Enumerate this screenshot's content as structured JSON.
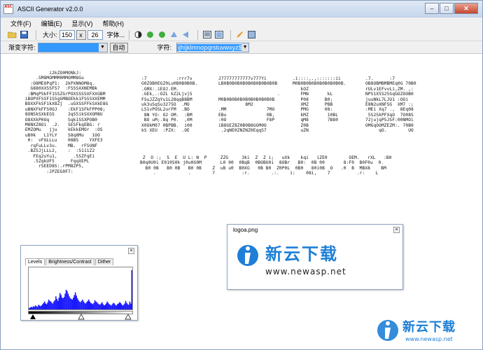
{
  "window": {
    "title": "ASCII Generator v2.0.0",
    "icon_text": "ASC\nBCD\nEFG"
  },
  "menu": [
    "文件(F)",
    "编辑(E)",
    "显示(V)",
    "帮助(H)"
  ],
  "toolbar": {
    "size_label": "大小:",
    "width": "150",
    "x_label": "x",
    "height": "26",
    "font_label": "字体..."
  },
  "toolbar2": {
    "ramp_label": "渐变字符:",
    "auto_label": "自动",
    "chars_label": "字符:",
    "chars_value": "ijhijklmnopqrstuvwxyz$"
  },
  "ascii_art": {
    "block_a": "          i2kZO0MONkJ:\n     .SM8MOMMM0MMOMM8Gu\n   :O8MEOPqP1:  2kPXNNOM8q.\n   G880XXSSFS7  :FSSSXXNEMBk\n  :BMqPSkFF1SSZGrPOXSSSSXFXXGBM\n iBOPXFSSF1S5gGMBOEkk1FSSSXXEMM\n BOXXFkSF1kX8Zj  .uGXSSFFkSXkE8G\n uBNXFkFFS0OJ    :EkF1SFkFPP08;\n 8ONSkSXkEGS     2qS5ikSXXGM8U\n O8XXkP0Oq       Sqk1SSXPOB0\n M8NXZ8Oi  .2.   SESFkqEBG: r\n EMZOMu   jju    kEkkEMOr  :OS\n uB0k   L1YLY    S8q8Mu   1OO\n  0:  vFULLLu    08BS    YXFE3\n   rqFuLLv3u.    MB.  rFSUNF\n  .BZSJjLLL2,    :  :S111Z2\n    FEq2uYu1,      .5SZFqEi\n    .5ZqkUF5      FqqXEPL\n      rSEED8S:.rPM8ZP5,\n         :JPZEG0F7:",
    "block_b": ":7           :rrr7v\nG0ZOB0EGZ0Lu0B0B0B0B.\n.GMX:.iEOJ.EM.\n.GEk,.:OZL kZ2LjvjS\nFSuJZZqYu1L28qqB8BM\nuk3uSqSu3275O  .MO\nLS1vPOSL2urFM  .BO\n 8N YO: O2 OM.  :BM\n BO uM;.8q P0.  ,0M\nX0OkM07 0BPBB.  i00\nkS XEU  :PZX:  .OE",
    "block_c": "J77777777777v777Yi\nLB0B0B0B0B0B0B0B0B0B0B\n\n                      .\nM0B0B0B0B0B0B0B0B0B0B\n          8M2\n.MM               7MO\nEBu               0B,\n:0O               F8P\niB8GEZ8Z0B0B8GGM0O\n .2qNE0ZNZNZ0EqqS7",
    "block_d": ".i::::,.,:::::::ii\nM0B0B0B0B0B0B0B0B0B.\n   kOZ\n   FMN       kL\n   P08      B0;\n   XMZ      PBB\n   PMG      08:\n   kMZ       10BL\n   qM8       7B80\n   Z0B\n   uZN",
    "block_e": ".7.      :7\nOB8OBMBMBMEq0G 70B0\nrULv1EFvvLi,ZM. ,:\nNPS1X5S25SqGOZOOB0\njuuNkL7LJU1 :OOi\nE8N2uXNFSG  XM7 :;\n:MEi Xq7 .,  8Eq08\n 5S2SkPFXqO  7O08S\n72jujqP5JSF:00NMOi\nOMGqOOMZEZM:. 70B0\n     qO.        UO",
    "bottom": " Z  O :;  S  E  U L: N  P     ZZG     3ki  Z  Z i;   uXk    kqi   iZE0        OEM.   rXL   :B0\nB0q0U0i E010S0k j0u0G0M       L0 00  0BqB  0BOBU0i  8OBr   B0:  0B 00       8:F0  B0F0u  0.\n  B0 0B   B0 0B   B0 0B    Z  uB u0  B0XG   0B B0  Z0P0L  0B0   80i0B  O   .0  B  MBX8    BM\n     .            .        7          :r.        .:.    i:    08i,    7          .r:    L"
  },
  "levels_panel": {
    "tabs": [
      "Levels",
      "Brightness/Contrast",
      "Dither"
    ],
    "histogram": [
      2,
      3,
      4,
      3,
      5,
      4,
      6,
      5,
      4,
      7,
      6,
      5,
      6,
      8,
      10,
      12,
      9,
      8,
      11,
      15,
      13,
      12,
      10,
      9,
      12,
      14,
      20,
      16,
      13,
      18,
      25,
      22,
      18,
      17,
      19,
      24,
      30,
      28,
      24,
      20,
      17,
      16,
      15,
      18,
      22,
      26,
      21,
      17,
      14,
      12,
      11,
      13,
      15,
      12,
      10,
      9,
      11,
      13,
      15,
      12,
      10,
      9,
      8,
      10,
      14,
      12,
      11,
      9,
      8,
      7,
      9,
      11,
      8,
      6,
      7,
      9,
      12,
      10,
      8,
      7,
      6,
      8,
      10,
      9,
      7,
      6,
      8,
      9,
      11,
      10,
      8,
      6,
      7,
      9,
      13,
      10,
      8,
      7,
      12,
      9,
      60
    ]
  },
  "logo_panel": {
    "title": "logoa.png",
    "brand_cn": "新云下载",
    "brand_url": "www.newasp.net"
  },
  "watermark": {
    "brand_cn": "新云下载",
    "brand_url": "www.newasp.net"
  },
  "colors": {
    "accent": "#3399ff",
    "logo_blue": "#1e7fd6"
  }
}
